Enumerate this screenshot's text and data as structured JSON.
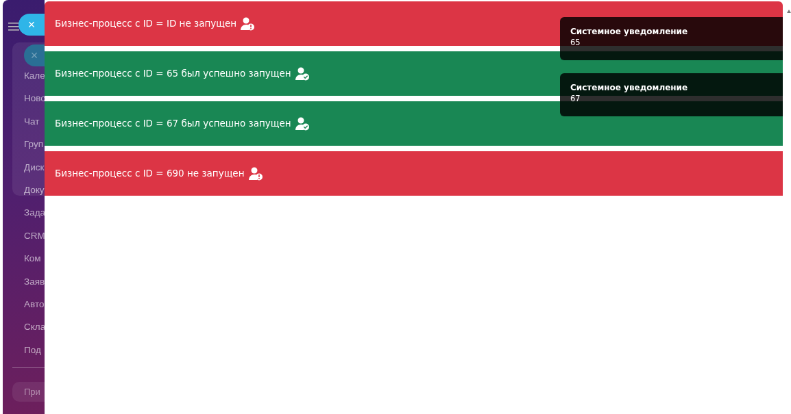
{
  "sidebar": {
    "close_buttons": [
      {
        "label": "×",
        "faded": false
      },
      {
        "label": "×",
        "faded": true
      }
    ],
    "group_items": [
      "Кале",
      "Ново",
      "Чат",
      "Груп",
      "Диск",
      "Доку"
    ],
    "items": [
      "Зада",
      "CRM",
      "Ком",
      "Заяв",
      "Авто",
      "Скла",
      "Под"
    ],
    "footer_item": "При"
  },
  "alerts": [
    {
      "kind": "error",
      "text": "Бизнес-процесс с ID = ID не запущен"
    },
    {
      "kind": "success",
      "text": "Бизнес-процесс с ID = 65 был успешно запущен"
    },
    {
      "kind": "success",
      "text": "Бизнес-процесс с ID = 67 был успешно запущен"
    },
    {
      "kind": "error",
      "text": "Бизнес-процесс с ID = 690 не запущен"
    }
  ],
  "toasts": [
    {
      "title": "Системное уведомление",
      "body": "65"
    },
    {
      "title": "Системное уведомление",
      "body": "67"
    }
  ]
}
